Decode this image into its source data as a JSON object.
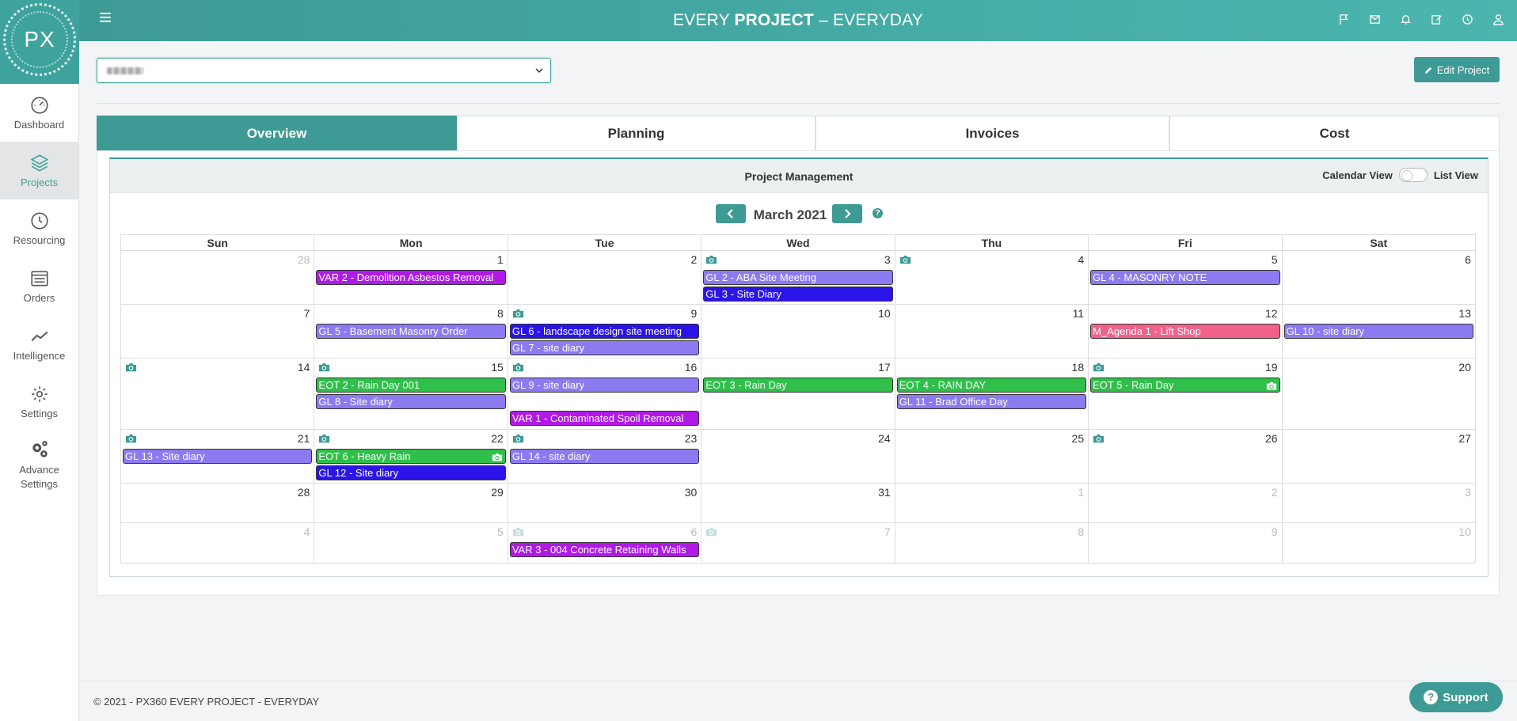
{
  "app": {
    "brand_light": "EVERY ",
    "brand_bold": "PROJECT",
    "brand_rest": " – EVERYDAY",
    "logo_text": "PX"
  },
  "sidebar": {
    "items": [
      {
        "label": "Dashboard",
        "icon": "speedometer-icon",
        "active": false
      },
      {
        "label": "Projects",
        "icon": "layers-icon",
        "active": true
      },
      {
        "label": "Resourcing",
        "icon": "clock-icon",
        "active": false
      },
      {
        "label": "Orders",
        "icon": "list-icon",
        "active": false
      },
      {
        "label": "Intelligence",
        "icon": "trend-icon",
        "active": false
      },
      {
        "label": "Settings",
        "icon": "gear-icon",
        "active": false
      },
      {
        "label": "Advance Settings",
        "icon": "gears-icon",
        "active": false
      }
    ]
  },
  "header_icons": [
    "flag-icon",
    "envelope-icon",
    "bell-icon",
    "edit-icon",
    "clock-icon",
    "user-icon"
  ],
  "toolbar": {
    "edit_label": "Edit Project"
  },
  "tabs": [
    "Overview",
    "Planning",
    "Invoices",
    "Cost"
  ],
  "panel": {
    "title": "Project Management",
    "calendar_view_label": "Calendar View",
    "list_view_label": "List View"
  },
  "calendar": {
    "month_label": "March 2021",
    "weekdays": [
      "Sun",
      "Mon",
      "Tue",
      "Wed",
      "Thu",
      "Fri",
      "Sat"
    ],
    "weeks": [
      [
        {
          "day": "28",
          "muted": true,
          "cam": false,
          "events": []
        },
        {
          "day": "1",
          "muted": false,
          "cam": false,
          "events": [
            {
              "label": "VAR 2 - Demolition Asbestos Removal",
              "type": "var"
            }
          ]
        },
        {
          "day": "2",
          "muted": false,
          "cam": false,
          "events": []
        },
        {
          "day": "3",
          "muted": false,
          "cam": true,
          "events": [
            {
              "label": "GL 2 - ABA Site Meeting",
              "type": "gl"
            },
            {
              "label": "GL 3 - Site Diary",
              "type": "gl-dark"
            }
          ]
        },
        {
          "day": "4",
          "muted": false,
          "cam": true,
          "events": []
        },
        {
          "day": "5",
          "muted": false,
          "cam": false,
          "events": [
            {
              "label": "GL 4 - MASONRY NOTE",
              "type": "gl"
            }
          ]
        },
        {
          "day": "6",
          "muted": false,
          "cam": false,
          "events": []
        }
      ],
      [
        {
          "day": "7",
          "muted": false,
          "cam": false,
          "events": []
        },
        {
          "day": "8",
          "muted": false,
          "cam": false,
          "events": [
            {
              "label": "GL 5 - Basement Masonry Order",
              "type": "gl"
            }
          ]
        },
        {
          "day": "9",
          "muted": false,
          "cam": true,
          "events": [
            {
              "label": "GL 6 - landscape design site meeting",
              "type": "gl-dark"
            },
            {
              "label": "GL 7 - site diary",
              "type": "gl"
            }
          ]
        },
        {
          "day": "10",
          "muted": false,
          "cam": false,
          "events": []
        },
        {
          "day": "11",
          "muted": false,
          "cam": false,
          "events": []
        },
        {
          "day": "12",
          "muted": false,
          "cam": false,
          "events": [
            {
              "label": "M_Agenda 1 - Lift Shop",
              "type": "agenda"
            }
          ]
        },
        {
          "day": "13",
          "muted": false,
          "cam": false,
          "events": [
            {
              "label": "GL 10 - site diary",
              "type": "gl"
            }
          ]
        }
      ],
      [
        {
          "day": "14",
          "muted": false,
          "cam": true,
          "events": []
        },
        {
          "day": "15",
          "muted": false,
          "cam": true,
          "events": [
            {
              "label": "EOT 2 - Rain Day 001",
              "type": "eot"
            },
            {
              "label": "GL 8 - Site diary",
              "type": "gl"
            }
          ]
        },
        {
          "day": "16",
          "muted": false,
          "cam": true,
          "events": [
            {
              "label": "GL 9 - site diary",
              "type": "gl"
            },
            {
              "label": "",
              "type": "spacer"
            },
            {
              "label": "VAR 1 - Contaminated Spoil Removal",
              "type": "var"
            }
          ]
        },
        {
          "day": "17",
          "muted": false,
          "cam": false,
          "events": [
            {
              "label": "EOT 3 - Rain Day",
              "type": "eot"
            }
          ]
        },
        {
          "day": "18",
          "muted": false,
          "cam": false,
          "events": [
            {
              "label": "EOT 4 - RAIN DAY",
              "type": "eot"
            },
            {
              "label": "GL 11 - Brad Office Day",
              "type": "gl"
            }
          ]
        },
        {
          "day": "19",
          "muted": false,
          "cam": true,
          "events": [
            {
              "label": "EOT 5 - Rain Day",
              "type": "eot",
              "cam": true
            }
          ]
        },
        {
          "day": "20",
          "muted": false,
          "cam": false,
          "events": []
        }
      ],
      [
        {
          "day": "21",
          "muted": false,
          "cam": true,
          "events": [
            {
              "label": "GL 13 - Site diary",
              "type": "gl"
            }
          ]
        },
        {
          "day": "22",
          "muted": false,
          "cam": true,
          "events": [
            {
              "label": "EOT 6 - Heavy Rain",
              "type": "eot",
              "cam": true
            },
            {
              "label": "GL 12 - Site diary",
              "type": "gl-dark"
            }
          ]
        },
        {
          "day": "23",
          "muted": false,
          "cam": true,
          "events": [
            {
              "label": "GL 14 - site diary",
              "type": "gl"
            }
          ]
        },
        {
          "day": "24",
          "muted": false,
          "cam": false,
          "events": []
        },
        {
          "day": "25",
          "muted": false,
          "cam": false,
          "events": []
        },
        {
          "day": "26",
          "muted": false,
          "cam": true,
          "events": []
        },
        {
          "day": "27",
          "muted": false,
          "cam": false,
          "events": []
        }
      ],
      [
        {
          "day": "28",
          "muted": false,
          "cam": false,
          "events": []
        },
        {
          "day": "29",
          "muted": false,
          "cam": false,
          "events": []
        },
        {
          "day": "30",
          "muted": false,
          "cam": false,
          "events": []
        },
        {
          "day": "31",
          "muted": false,
          "cam": false,
          "events": []
        },
        {
          "day": "1",
          "muted": true,
          "cam": false,
          "events": []
        },
        {
          "day": "2",
          "muted": true,
          "cam": false,
          "events": []
        },
        {
          "day": "3",
          "muted": true,
          "cam": false,
          "events": []
        }
      ],
      [
        {
          "day": "4",
          "muted": true,
          "cam": false,
          "events": []
        },
        {
          "day": "5",
          "muted": true,
          "cam": false,
          "events": []
        },
        {
          "day": "6",
          "muted": true,
          "cam": true,
          "events": [
            {
              "label": "VAR 3 - 004 Concrete Retaining Walls",
              "type": "var"
            }
          ]
        },
        {
          "day": "7",
          "muted": true,
          "cam": true,
          "events": []
        },
        {
          "day": "8",
          "muted": true,
          "cam": false,
          "events": []
        },
        {
          "day": "9",
          "muted": true,
          "cam": false,
          "events": []
        },
        {
          "day": "10",
          "muted": true,
          "cam": false,
          "events": []
        }
      ]
    ]
  },
  "event_colors": {
    "var": "#b11ae6",
    "gl": "#8c7af0",
    "gl-dark": "#2a14e8",
    "eot": "#2fbf4a",
    "agenda": "#f0628a"
  },
  "footer": {
    "text": "© 2021 - PX360 EVERY PROJECT - EVERYDAY",
    "support_label": "Support"
  }
}
